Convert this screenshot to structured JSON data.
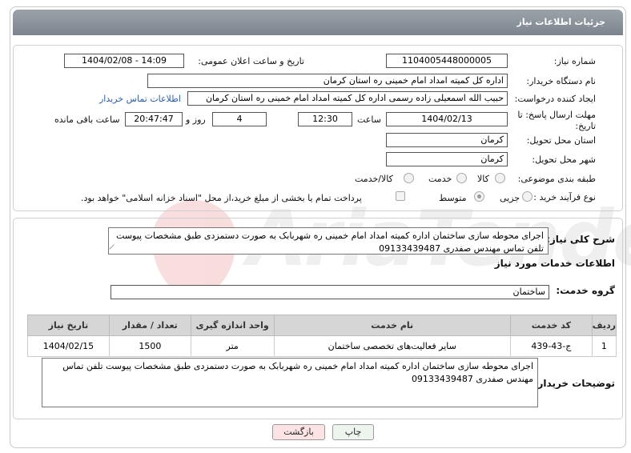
{
  "header": {
    "title": "جزئیات اطلاعات نیاز"
  },
  "form": {
    "need_number_label": "شماره نیاز:",
    "need_number": "1104005448000005",
    "announce_label": "تاریخ و ساعت اعلان عمومی:",
    "announce_value": "1404/02/08 - 14:09",
    "buyer_org_label": "نام دستگاه خریدار:",
    "buyer_org": "اداره کل کمیته امداد امام خمینی  ره  استان کرمان",
    "requester_label": "ایجاد کننده درخواست:",
    "requester": "حبیب الله اسمعیلی زاده رسمی  اداره کل کمیته امداد امام خمینی  ره  استان کرمان",
    "contact_link": "اطلاعات تماس خریدار",
    "deadline_label": "مهلت ارسال پاسخ: تا تاریخ:",
    "deadline_date": "1404/02/13",
    "time_label": "ساعت",
    "deadline_time": "12:30",
    "days_value": "4",
    "days_label": "روز و",
    "remaining_time": "20:47:47",
    "remaining_label": "ساعت باقی مانده",
    "province_label": "استان محل تحویل:",
    "province": "کرمان",
    "city_label": "شهر محل تحویل:",
    "city": "کرمان",
    "category_label": "طبقه بندی موضوعی:",
    "category_options": [
      "کالا",
      "خدمت",
      "کالا/خدمت"
    ],
    "purchase_label": "نوع فرآیند خرید :",
    "purchase_options": [
      "جزیی",
      "متوسط"
    ],
    "payment_note": "پرداخت تمام یا بخشی از مبلغ خرید،از محل \"اسناد خزانه اسلامی\" خواهد بود."
  },
  "details": {
    "summary_label": "شرح کلی نیاز:",
    "summary_text": "اجرای محوطه سازی ساختمان اداره کمیته امداد امام خمینی ره شهربابک به صورت دستمزدی طبق مشخصات پیوست تلفن تماس مهندس صفدری 09133439487",
    "services_title": "اطلاعات خدمات مورد نیاز",
    "service_group_label": "گروه خدمت:",
    "service_group": "ساختمان",
    "table": {
      "headers": [
        "ردیف",
        "کد خدمت",
        "نام خدمت",
        "واحد اندازه گیری",
        "تعداد / مقدار",
        "تاریخ نیاز"
      ],
      "rows": [
        [
          "1",
          "ج-43-439",
          "سایر فعالیت‌های تخصصی ساختمان",
          "متر",
          "1500",
          "1404/02/15"
        ]
      ]
    },
    "buyer_notes_label": "توضیحات خریدار:",
    "buyer_notes": "اجرای محوطه سازی ساختمان اداره کمیته امداد امام خمینی ره شهربابک به صورت دستمزدی طبق مشخصات پیوست تلفن تماس مهندس صفدری 09133439487"
  },
  "buttons": {
    "print": "چاپ",
    "back": "بازگشت"
  },
  "watermark": {
    "text": "AriaTender.neT"
  },
  "colors": {
    "header": "#8a939b",
    "link": "#2a5db0",
    "back_btn_bg": "#fde4e4",
    "print_btn_bg": "#eef5ee"
  }
}
